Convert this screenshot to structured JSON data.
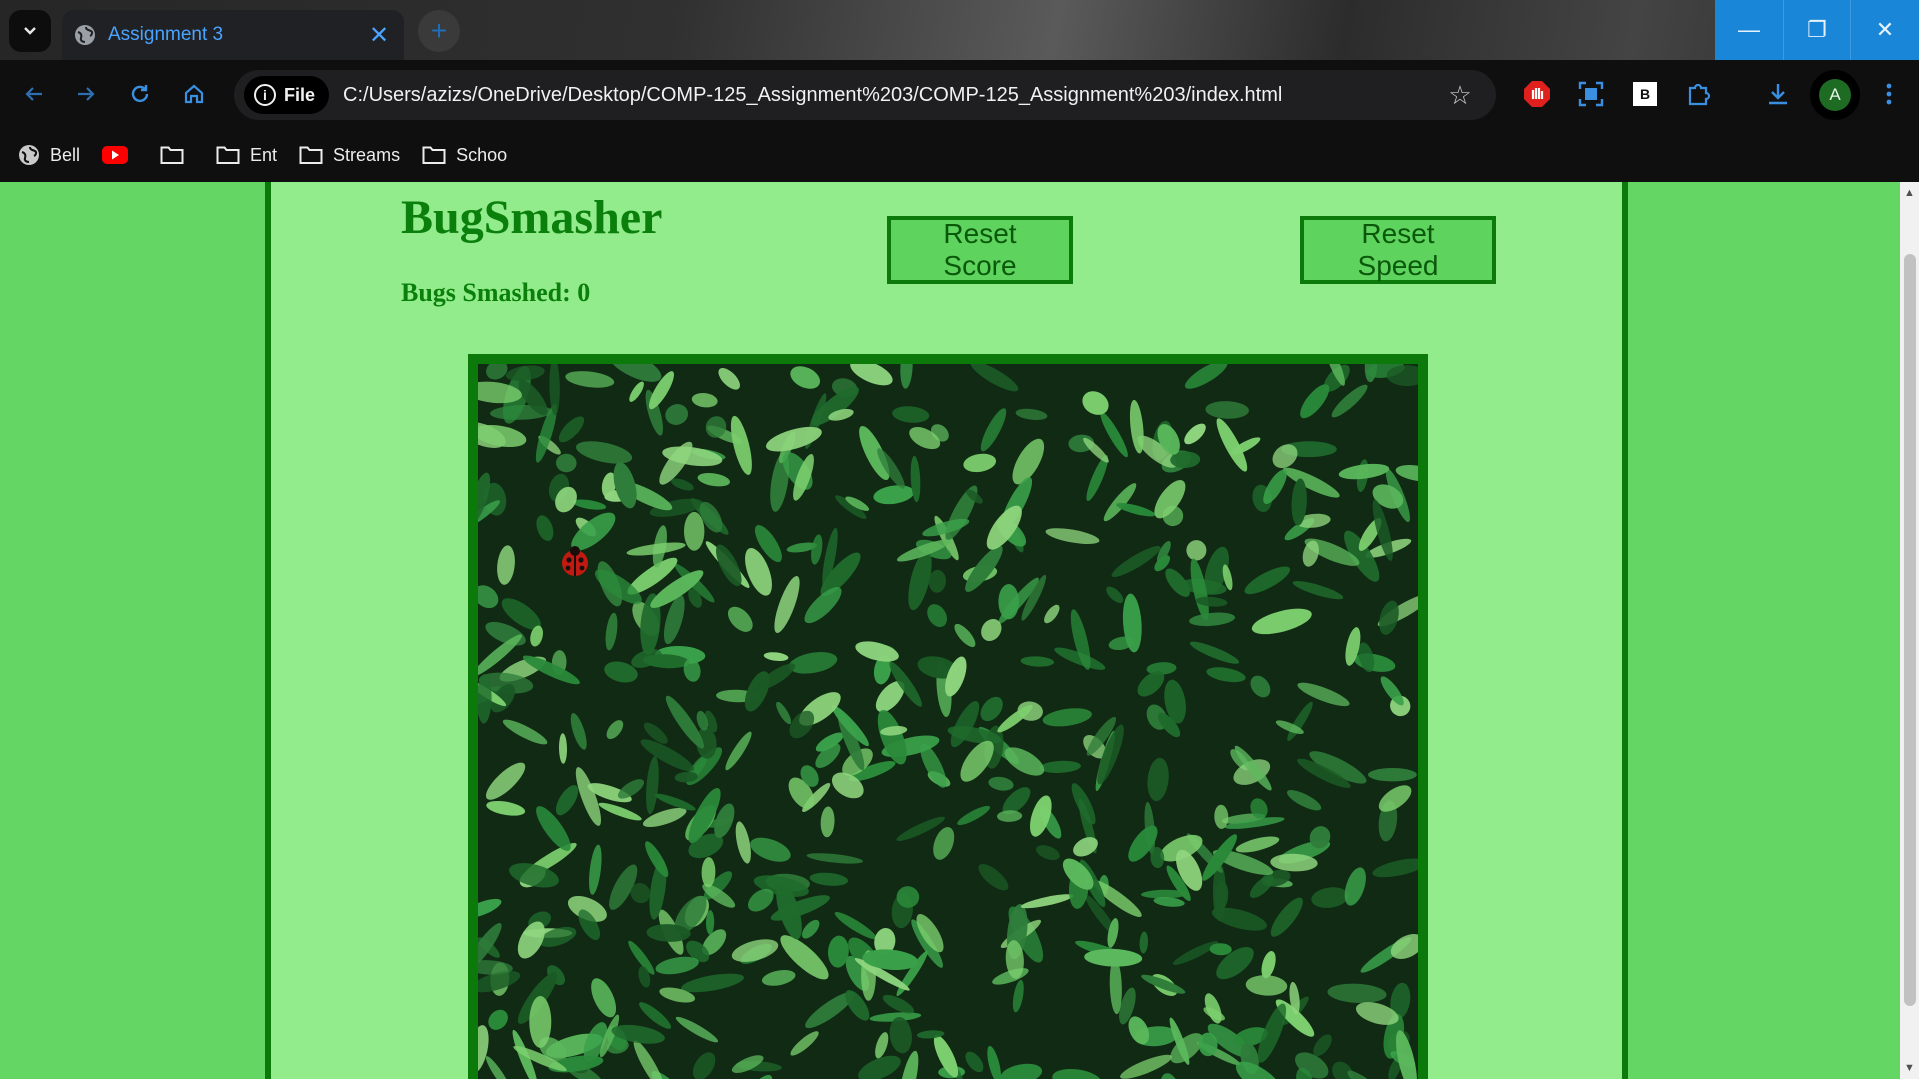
{
  "browser": {
    "tab_title": "Assignment 3",
    "site_chip_label": "File",
    "url": "C:/Users/azizs/OneDrive/Desktop/COMP-125_Assignment%203/COMP-125_Assignment%203/index.html",
    "profile_initial": "A",
    "extension_badge": "B"
  },
  "bookmarks": [
    {
      "label": "Bell",
      "icon": "globe-icon"
    },
    {
      "label": "",
      "icon": "youtube-icon"
    },
    {
      "label": "",
      "icon": "folder-icon"
    },
    {
      "label": "Ent",
      "icon": "folder-icon"
    },
    {
      "label": "Streams",
      "icon": "folder-icon"
    },
    {
      "label": "Schoo",
      "icon": "folder-icon"
    }
  ],
  "game": {
    "title": "BugSmasher",
    "score_text": "Bugs Smashed: 0",
    "reset_score_label": "Reset Score",
    "reset_speed_label": "Reset Speed"
  },
  "colors": {
    "page_bg": "#63d663",
    "column_bg": "#92ec8c",
    "accent_dark_green": "#0b7a0b",
    "button_bg": "#5ed35e",
    "window_controls": "#1a86d8",
    "tab_text": "#4aa3ff"
  }
}
